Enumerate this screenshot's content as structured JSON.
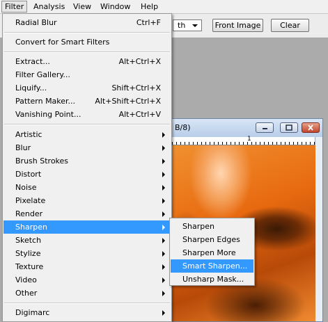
{
  "menubar": {
    "items": [
      "Filter",
      "Analysis",
      "View",
      "Window",
      "Help"
    ]
  },
  "options_bar": {
    "combo_value": "th",
    "front_image_label": "Front Image",
    "clear_label": "Clear"
  },
  "document": {
    "title_fragment": "B/8)",
    "ruler_mark": "1"
  },
  "filter_menu": {
    "last_filter": {
      "label": "Radial Blur",
      "shortcut": "Ctrl+F"
    },
    "convert": {
      "label": "Convert for Smart Filters"
    },
    "tools": [
      {
        "label": "Extract...",
        "shortcut": "Alt+Ctrl+X"
      },
      {
        "label": "Filter Gallery...",
        "shortcut": ""
      },
      {
        "label": "Liquify...",
        "shortcut": "Shift+Ctrl+X"
      },
      {
        "label": "Pattern Maker...",
        "shortcut": "Alt+Shift+Ctrl+X"
      },
      {
        "label": "Vanishing Point...",
        "shortcut": "Alt+Ctrl+V"
      }
    ],
    "groups": [
      {
        "label": "Artistic"
      },
      {
        "label": "Blur"
      },
      {
        "label": "Brush Strokes"
      },
      {
        "label": "Distort"
      },
      {
        "label": "Noise"
      },
      {
        "label": "Pixelate"
      },
      {
        "label": "Render"
      },
      {
        "label": "Sharpen",
        "highlighted": true
      },
      {
        "label": "Sketch"
      },
      {
        "label": "Stylize"
      },
      {
        "label": "Texture"
      },
      {
        "label": "Video"
      },
      {
        "label": "Other"
      }
    ],
    "plugins": [
      {
        "label": "Digimarc"
      }
    ]
  },
  "sharpen_submenu": {
    "items": [
      {
        "label": "Sharpen"
      },
      {
        "label": "Sharpen Edges"
      },
      {
        "label": "Sharpen More"
      },
      {
        "label": "Smart Sharpen...",
        "highlighted": true
      },
      {
        "label": "Unsharp Mask..."
      }
    ]
  },
  "colors": {
    "highlight": "#3399ff",
    "menu_bg": "#f0f0f0",
    "canvas_orange": "#e86a10"
  }
}
